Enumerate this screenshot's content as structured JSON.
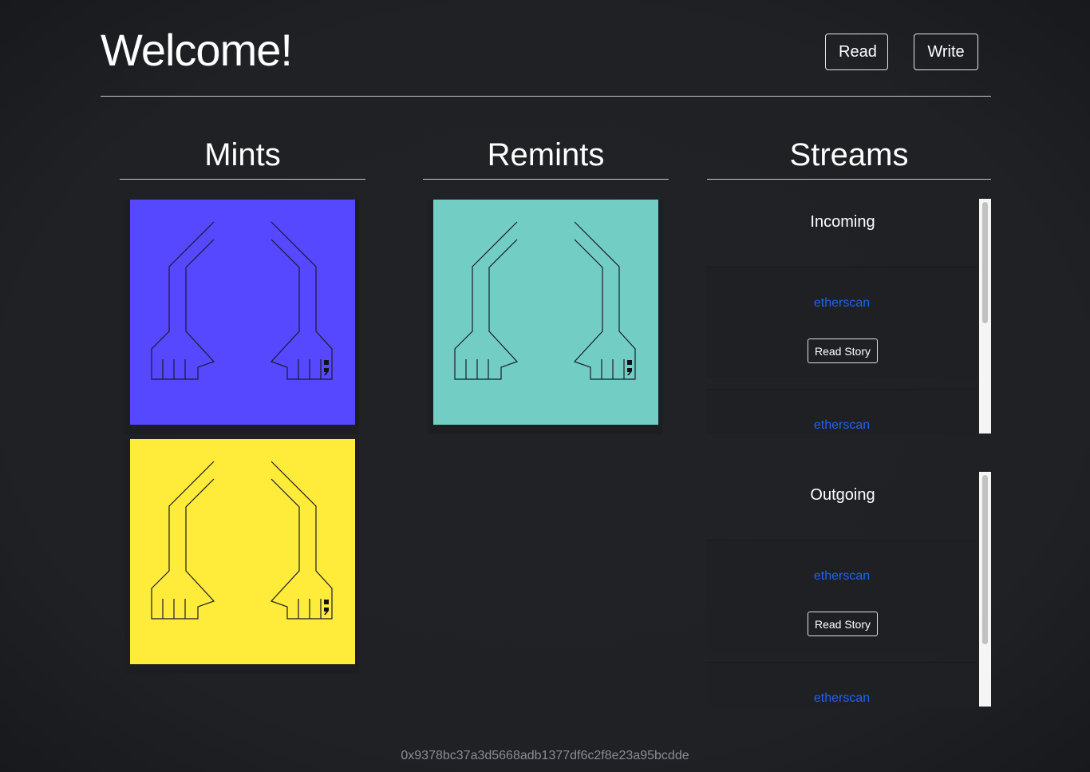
{
  "header": {
    "title": "Welcome!",
    "read_label": "Read",
    "write_label": "Write"
  },
  "columns": {
    "mints": "Mints",
    "remints": "Remints",
    "streams": "Streams"
  },
  "mints": [
    {
      "color": "#5548fe"
    },
    {
      "color": "#ffeb3a"
    }
  ],
  "remints": [
    {
      "color": "#72cec4"
    }
  ],
  "streams": {
    "incoming": {
      "label": "Incoming",
      "items": [
        {
          "link": "etherscan",
          "button": "Read Story"
        },
        {
          "link": "etherscan"
        }
      ]
    },
    "outgoing": {
      "label": "Outgoing",
      "items": [
        {
          "link": "etherscan",
          "button": "Read Story"
        },
        {
          "link": "etherscan"
        }
      ]
    }
  },
  "footer": {
    "address": "0x9378bc37a3d5668adb1377df6c2f8e23a95bcdde"
  }
}
